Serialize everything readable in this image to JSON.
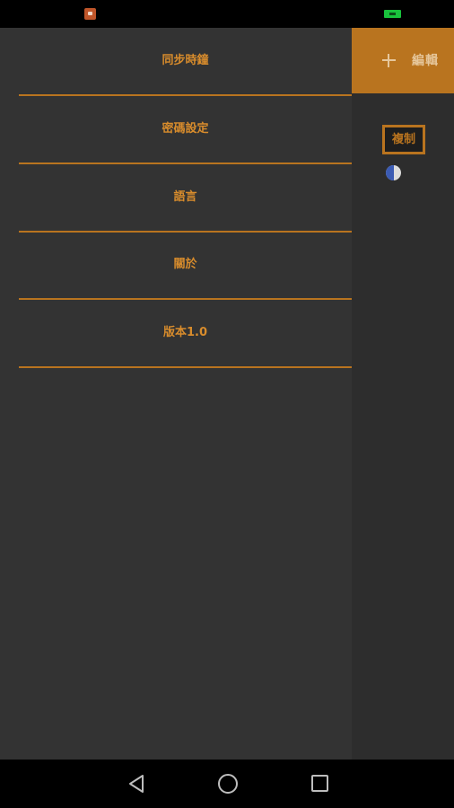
{
  "status_bar": {
    "notification_icon": "app-notification-icon",
    "battery_icon": "battery-charging-icon",
    "battery_color": "#19c23c"
  },
  "drawer": {
    "items": [
      {
        "label": "同步時鐘"
      },
      {
        "label": "密碼設定"
      },
      {
        "label": "語言"
      },
      {
        "label": "關於"
      },
      {
        "label": "版本1.0"
      }
    ]
  },
  "main": {
    "toolbar": {
      "add_icon": "plus-icon",
      "edit_label": "編輯"
    },
    "copy_button_label": "複制",
    "moon_icon": "moon-phase-icon"
  },
  "nav_bar": {
    "back_icon": "back-triangle-icon",
    "home_icon": "home-circle-icon",
    "recents_icon": "recents-square-icon"
  },
  "colors": {
    "accent": "#b9741f",
    "label": "#d88c2c",
    "drawer_bg": "#333333",
    "main_bg": "#2d2d2d"
  }
}
